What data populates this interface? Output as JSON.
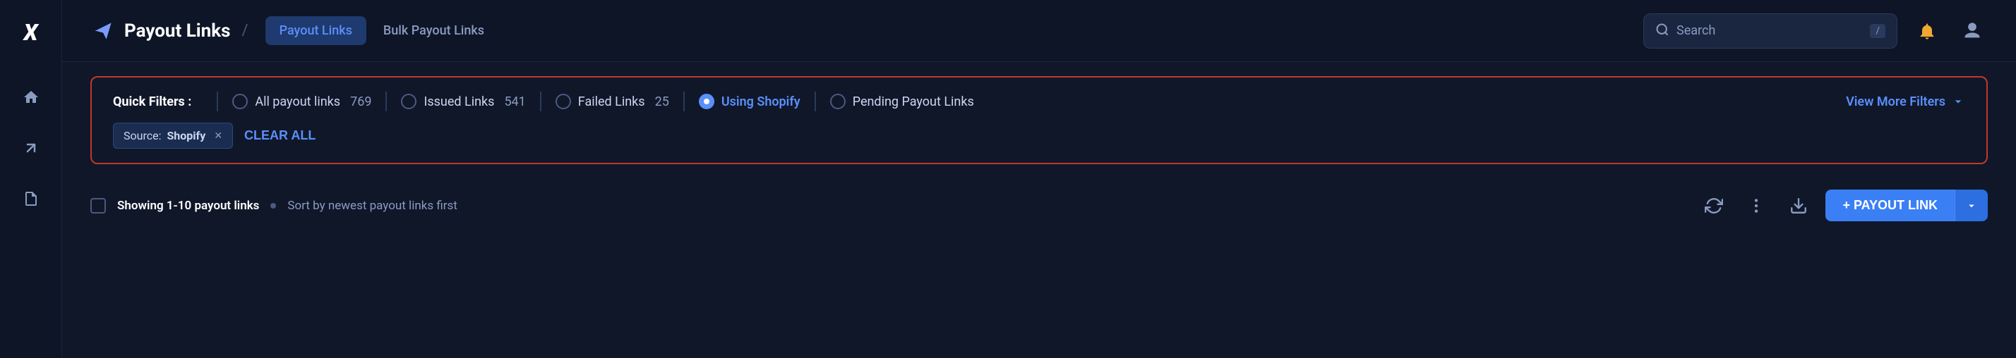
{
  "app": {
    "logo": "X"
  },
  "sidebar": {
    "items": [
      {
        "name": "home",
        "icon": "home"
      },
      {
        "name": "arrow-up-right",
        "icon": "arrow-up-right"
      },
      {
        "name": "document",
        "icon": "document"
      }
    ]
  },
  "topbar": {
    "payout_icon": "➤",
    "title": "Payout Links",
    "separator": "/",
    "tabs": [
      {
        "label": "Payout Links",
        "active": true
      },
      {
        "label": "Bulk Payout Links",
        "active": false
      }
    ],
    "search": {
      "placeholder": "Search",
      "kbd": "/"
    },
    "notification_icon": "🔔",
    "user_icon": "👤"
  },
  "filters": {
    "label": "Quick Filters :",
    "options": [
      {
        "label": "All payout links",
        "count": "769",
        "checked": false
      },
      {
        "label": "Issued Links",
        "count": "541",
        "checked": false
      },
      {
        "label": "Failed Links",
        "count": "25",
        "checked": false
      },
      {
        "label": "Using Shopify",
        "count": "",
        "checked": true
      },
      {
        "label": "Pending Payout Links",
        "count": "",
        "checked": false
      }
    ],
    "view_more": "View More Filters",
    "active_tags": [
      {
        "prefix": "Source:",
        "value": "Shopify"
      }
    ],
    "clear_all": "CLEAR ALL"
  },
  "table_bar": {
    "showing_text": "Showing 1-10 payout links",
    "sort_text": "Sort by newest payout links first",
    "refresh_icon": "↻",
    "more_icon": "⋮",
    "download_icon": "⬇",
    "add_button": "+ PAYOUT LINK",
    "dropdown_icon": "▾"
  }
}
